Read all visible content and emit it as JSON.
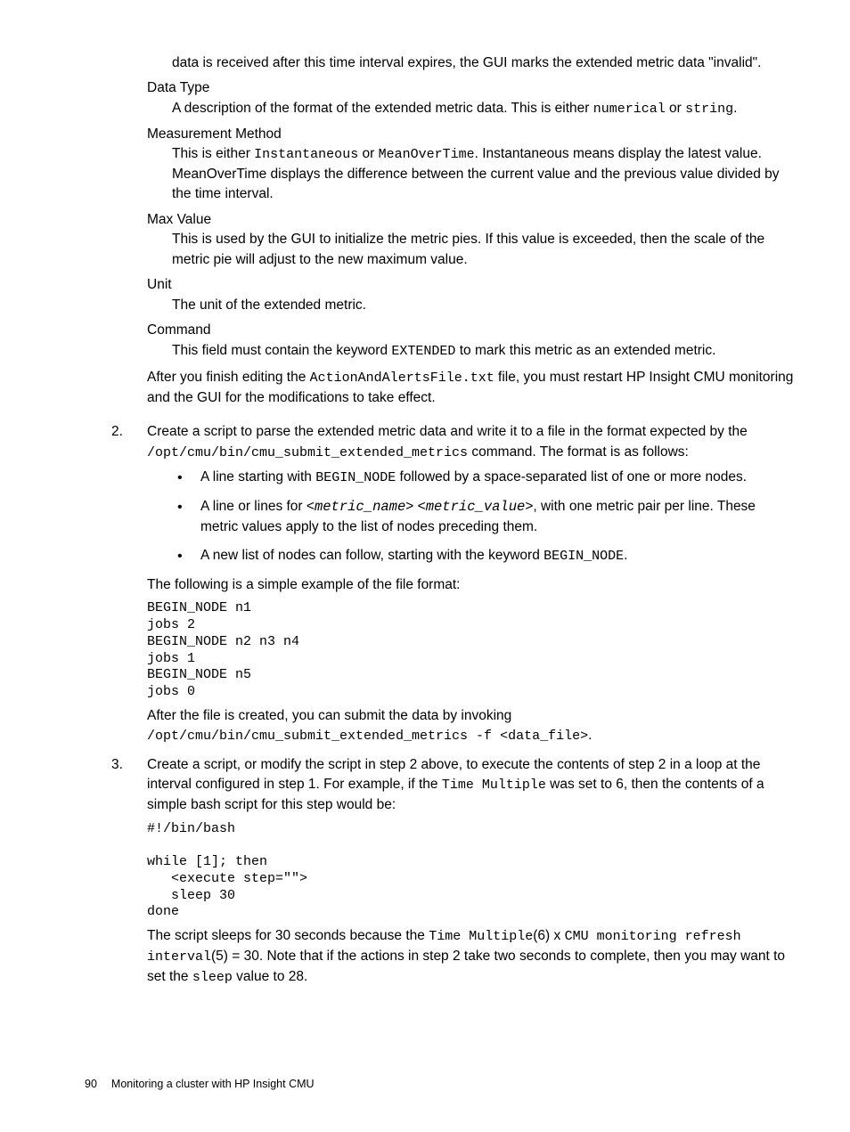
{
  "dl": {
    "before_dt_orphan": "data is received after this time interval expires, the GUI marks the extended metric data \"invalid\".",
    "data_type_label": "Data Type",
    "data_type_desc_pre": "A description of the format of the extended metric data. This is either ",
    "data_type_code1": "numerical",
    "data_type_desc_mid": " or ",
    "data_type_code2": "string",
    "data_type_desc_post": ".",
    "meas_label": "Measurement Method",
    "meas_desc_pre": "This is either ",
    "meas_code1": "Instantaneous",
    "meas_mid1": " or ",
    "meas_code2": "MeanOverTime",
    "meas_desc_post": ". Instantaneous means display the latest value. MeanOverTime displays the difference between the current value and the previous value divided by the time interval.",
    "max_label": "Max Value",
    "max_desc": "This is used by the GUI to initialize the metric pies. If this value is exceeded, then the scale of the metric pie will adjust to the new maximum value.",
    "unit_label": "Unit",
    "unit_desc": "The unit of the extended metric.",
    "cmd_label": "Command",
    "cmd_desc_pre": "This field must contain the keyword ",
    "cmd_code": "EXTENDED",
    "cmd_desc_post": " to mark this metric as an extended metric."
  },
  "after_dl": {
    "p1_pre": "After you finish editing the ",
    "p1_code": "ActionAndAlertsFile.txt",
    "p1_post": " file, you must restart HP Insight CMU monitoring and the GUI for the modifications to take effect."
  },
  "step2": {
    "num": "2.",
    "p1_pre": "Create a script to parse the extended metric data and write it to a file in the format expected by the ",
    "p1_code": "/opt/cmu/bin/cmu_submit_extended_metrics",
    "p1_post": " command. The format is as follows:",
    "b1_pre": "A line starting with ",
    "b1_code": "BEGIN_NODE",
    "b1_post": " followed by a space-separated list of one or more nodes.",
    "b2_pre": "A line or lines for <",
    "b2_i1": "metric_name",
    "b2_mid": "> <",
    "b2_i2": "metric_value",
    "b2_post": ">, with one metric pair per line. These metric values apply to the list of nodes preceding them.",
    "b3_pre": "A new list of nodes can follow, starting with the keyword ",
    "b3_code": "BEGIN_NODE",
    "b3_post": ".",
    "p2": "The following is a simple example of the file format:",
    "code1": "BEGIN_NODE n1\njobs 2\nBEGIN_NODE n2 n3 n4\njobs 1\nBEGIN_NODE n5\njobs 0",
    "p3_pre": "After the file is created, you can submit the data by invoking ",
    "p3_code": "/opt/cmu/bin/cmu_submit_extended_metrics -f <data_file>",
    "p3_post": "."
  },
  "step3": {
    "num": "3.",
    "p1_pre": "Create a script, or modify the script in step 2 above, to execute the contents of step 2 in a loop at the interval configured in step 1. For example, if the ",
    "p1_code": "Time Multiple",
    "p1_post": " was set to 6, then the contents of a simple bash script for this step would be:",
    "code1": "#!/bin/bash\n\nwhile [1]; then\n   <execute step=\"\">\n   sleep 30\ndone",
    "p2_pre": "The script sleeps for 30 seconds because the ",
    "p2_c1": "Time Multiple",
    "p2_mid1": "(6) x ",
    "p2_c2": "CMU monitoring refresh interval",
    "p2_mid2": "(5) = 30. Note that if the actions in step 2 take two seconds to complete, then you may want to set the ",
    "p2_c3": "sleep",
    "p2_post": " value to 28."
  },
  "footer": {
    "page": "90",
    "text": "Monitoring a cluster with HP Insight CMU"
  }
}
